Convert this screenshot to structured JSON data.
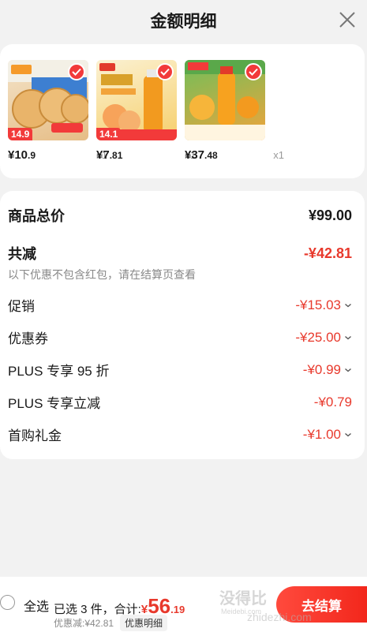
{
  "header": {
    "title": "金额明细"
  },
  "products": [
    {
      "price_main": "¥10",
      "price_dec": ".9",
      "qty": "x1",
      "tag": "14.9",
      "thumb_color": "#e8c9a0"
    },
    {
      "price_main": "¥7",
      "price_dec": ".81",
      "qty": "x1",
      "tag": "14.1",
      "thumb_color": "#f7d05c"
    },
    {
      "price_main": "¥37",
      "price_dec": ".48",
      "qty": "x1",
      "tag": "",
      "thumb_color": "#f2a33a"
    }
  ],
  "summary": {
    "total_label": "商品总价",
    "total_value": "¥99.00",
    "reduce_label": "共减",
    "reduce_value": "-¥42.81",
    "note": "以下优惠不包含红包，请在结算页查看",
    "items": [
      {
        "label": "促销",
        "value": "-¥15.03",
        "expandable": true
      },
      {
        "label": "优惠券",
        "value": "-¥25.00",
        "expandable": true
      },
      {
        "label": "PLUS 专享 95 折",
        "value": "-¥0.99",
        "expandable": true
      },
      {
        "label": "PLUS 专享立减",
        "value": "-¥0.79",
        "expandable": false
      },
      {
        "label": "首购礼金",
        "value": "-¥1.00",
        "expandable": true
      }
    ]
  },
  "bottom": {
    "select_all": "全选",
    "selected_text": "已选 3 件，合计:",
    "total_currency": "¥",
    "total_int": "56",
    "total_dec": ".19",
    "discount_text": "优惠减:¥42.81",
    "detail_label": "优惠明细",
    "checkout_label": "去结算"
  },
  "watermark": {
    "line1": "没得比",
    "line2": "zhidezhi.com",
    "line3": "Meidebi.com"
  },
  "colors": {
    "accent": "#e8392c",
    "check": "#f23a3a"
  }
}
